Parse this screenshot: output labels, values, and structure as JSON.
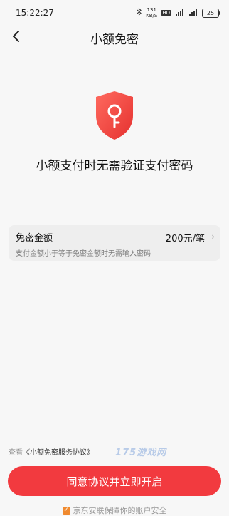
{
  "status_bar": {
    "time": "15:22:27",
    "net_speed_value": "131",
    "net_speed_unit": "KB/S",
    "hd_badge": "HD",
    "battery": "25",
    "icons": [
      "bluetooth-icon",
      "signal-icon",
      "wifi-icon",
      "battery-icon"
    ]
  },
  "nav": {
    "title": "小额免密",
    "back_icon": "chevron-left-icon"
  },
  "hero": {
    "icon": "shield-key-icon",
    "headline": "小额支付时无需验证支付密码"
  },
  "amount_card": {
    "title": "免密金额",
    "value": "200元/笔",
    "subtitle": "支付金额小于等于免密金额时无需输入密码",
    "chevron": "›"
  },
  "protocol": {
    "prefix": "查看",
    "link": "《小额免密服务协议》"
  },
  "watermark": "175游戏网",
  "cta": {
    "label": "同意协议并立即开启"
  },
  "footer": {
    "text": "京东安联保障你的账户安全",
    "check": "✓"
  },
  "colors": {
    "accent": "#f23a3f",
    "shield": "#ef4444",
    "background": "#f7f7f7",
    "check": "#f08a2f"
  }
}
